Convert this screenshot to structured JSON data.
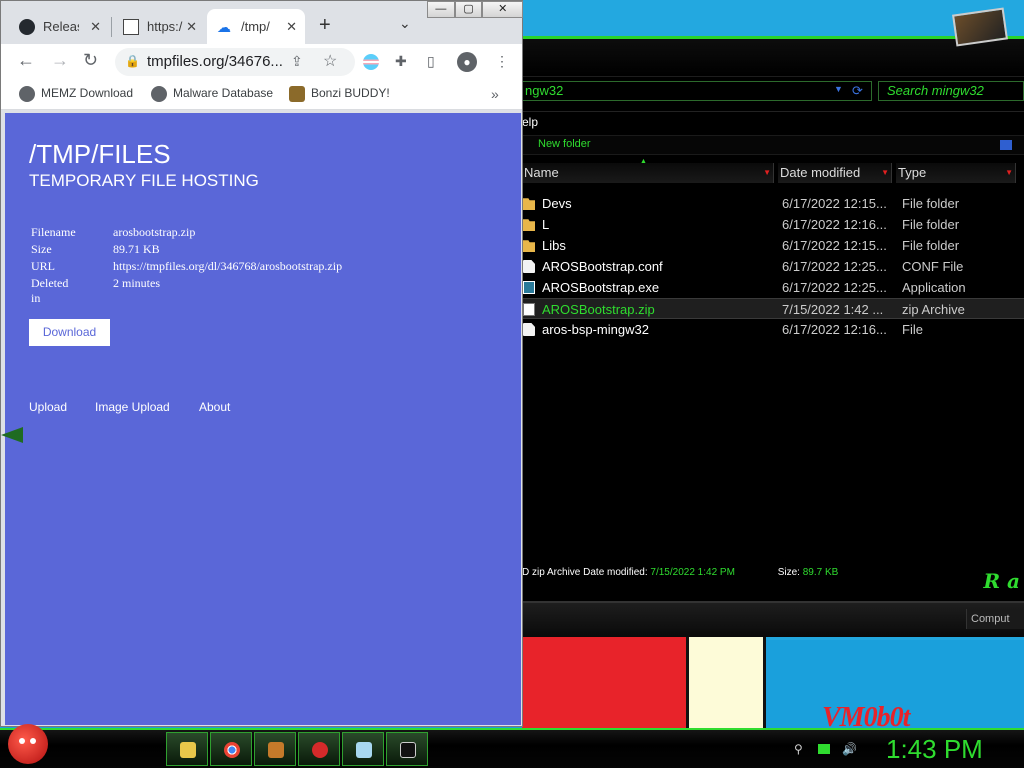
{
  "browser": {
    "tabs": [
      {
        "label": "Releas",
        "icon": "github-icon",
        "active": false
      },
      {
        "label": "https:/",
        "icon": "binary-file-icon",
        "active": false
      },
      {
        "label": "/tmp/",
        "icon": "cloud-upload-icon",
        "active": true
      }
    ],
    "window_controls": {
      "minimize": "—",
      "maximize": "▢",
      "close": "✕"
    },
    "omnibox": {
      "url": "tmpfiles.org/34676..."
    },
    "bookmarks": [
      {
        "label": "MEMZ Download",
        "icon": "globe-icon"
      },
      {
        "label": "Malware Database",
        "icon": "globe-icon"
      },
      {
        "label": "Bonzi BUDDY!",
        "icon": "bonzi-icon"
      }
    ],
    "bookmarks_more": "»"
  },
  "page": {
    "title": "/TMP/FILES",
    "subtitle": "TEMPORARY FILE HOSTING",
    "info": [
      {
        "key": "Filename",
        "value": "arosbootstrap.zip"
      },
      {
        "key": "Size",
        "value": "89.71 KB"
      },
      {
        "key": "URL",
        "value": "https://tmpfiles.org/dl/346768/arosbootstrap.zip"
      },
      {
        "key": "Deleted in",
        "value": "2 minutes"
      }
    ],
    "download_label": "Download",
    "nav_links": [
      "Upload",
      "Image Upload",
      "About"
    ],
    "background_color": "#5a67d8"
  },
  "explorer": {
    "address": "ngw32",
    "search_placeholder": "Search mingw32",
    "menu_fragment": "elp",
    "new_folder": "New folder",
    "columns": [
      "Name",
      "Date modified",
      "Type"
    ],
    "files": [
      {
        "name": "Devs",
        "date": "6/17/2022 12:15...",
        "type": "File folder",
        "icon": "folder-icon",
        "selected": false
      },
      {
        "name": "L",
        "date": "6/17/2022 12:16...",
        "type": "File folder",
        "icon": "folder-icon",
        "selected": false
      },
      {
        "name": "Libs",
        "date": "6/17/2022 12:15...",
        "type": "File folder",
        "icon": "folder-icon",
        "selected": false
      },
      {
        "name": "AROSBootstrap.conf",
        "date": "6/17/2022 12:25...",
        "type": "CONF File",
        "icon": "file-icon",
        "selected": false
      },
      {
        "name": "AROSBootstrap.exe",
        "date": "6/17/2022 12:25...",
        "type": "Application",
        "icon": "exe-icon",
        "selected": false
      },
      {
        "name": "AROSBootstrap.zip",
        "date": "7/15/2022 1:42 ...",
        "type": "zip Archive",
        "icon": "zip-icon",
        "selected": true
      },
      {
        "name": "aros-bsp-mingw32",
        "date": "6/17/2022 12:16...",
        "type": "File",
        "icon": "file-icon",
        "selected": false
      }
    ],
    "status": {
      "prefix": "D  zip Archive  Date modified:",
      "date": "7/15/2022 1:42 PM",
      "size_label": "Size:",
      "size": "89.7 KB"
    },
    "bottom_label": "Comput",
    "accent_color": "#2fdc2f"
  },
  "desktop": {
    "logo_text": "VM0b0t"
  },
  "taskbar": {
    "apps": [
      "explorer-icon",
      "chrome-icon",
      "paint-icon",
      "angry-birds-icon",
      "notepad-icon",
      "cmd-icon"
    ],
    "clock": "1:43 PM",
    "tray_icons": [
      "network-icon",
      "display-icon",
      "volume-icon"
    ]
  }
}
